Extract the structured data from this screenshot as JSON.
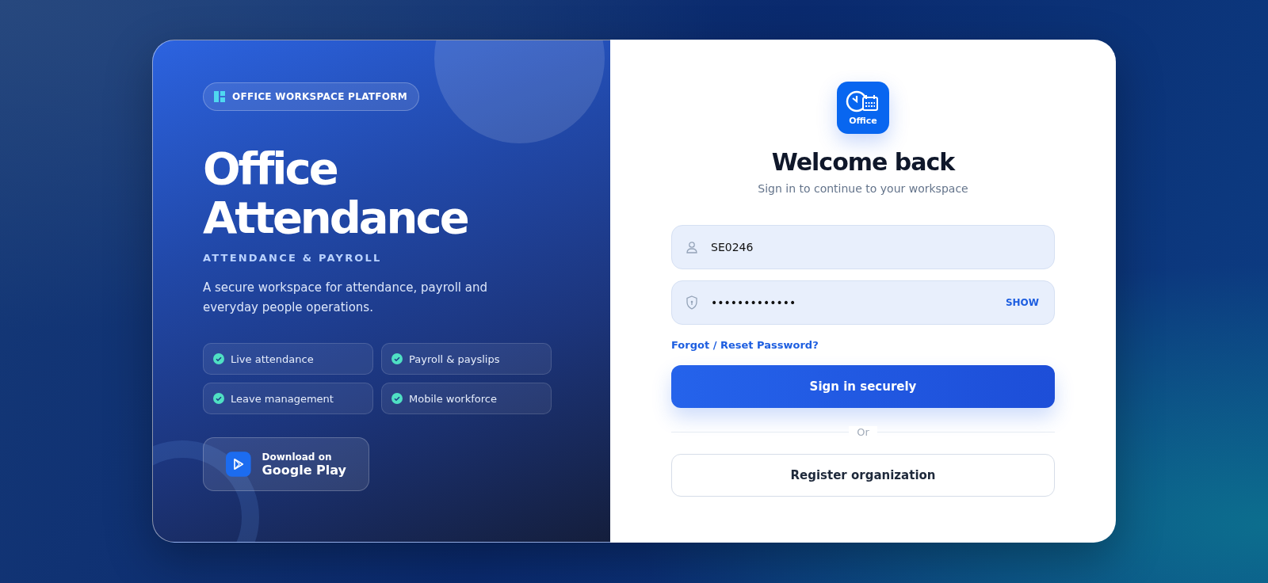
{
  "hero": {
    "badge": "OFFICE WORKSPACE PLATFORM",
    "title_lines": [
      "Office",
      "Attendance"
    ],
    "subtitle": "ATTENDANCE & PAYROLL",
    "description": "A secure workspace for attendance, payroll and everyday people operations.",
    "features": [
      {
        "label": "Live attendance"
      },
      {
        "label": "Payroll & payslips"
      },
      {
        "label": "Leave management"
      },
      {
        "label": "Mobile workforce"
      }
    ],
    "store_button": {
      "line1": "Download on",
      "line2": "Google Play"
    }
  },
  "form": {
    "app_icon_label": "Office",
    "title": "Welcome back",
    "subtitle": "Sign in to continue to your workspace",
    "username": {
      "value": "SE0246"
    },
    "password": {
      "value": "•••••••••••••",
      "toggle": "SHOW"
    },
    "forgot_link": "Forgot / Reset Password?",
    "submit": "Sign in securely",
    "divider": "Or",
    "register": "Register organization"
  }
}
